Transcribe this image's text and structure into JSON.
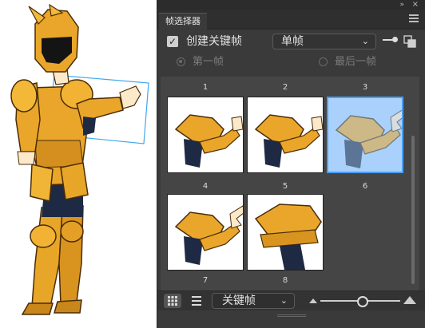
{
  "panel": {
    "tab_title": "帧选择器",
    "collapse_glyph": "»",
    "close_glyph": "×",
    "create_keyframe": {
      "label": "创建关键帧",
      "checked": true,
      "check_glyph": "✓"
    },
    "mode_dropdown": {
      "value": "单帧",
      "chevron": "⌄"
    },
    "radio_first": {
      "label": "第一帧",
      "selected": true,
      "enabled": false
    },
    "radio_last": {
      "label": "最后一帧",
      "selected": false,
      "enabled": false
    },
    "frames": [
      {
        "number": "1",
        "selected": false,
        "pose": "fist"
      },
      {
        "number": "2",
        "selected": false,
        "pose": "fist"
      },
      {
        "number": "3",
        "selected": true,
        "pose": "point"
      },
      {
        "number": "4",
        "selected": false,
        "pose": "point"
      },
      {
        "number": "5",
        "selected": false,
        "pose": "shoulder"
      },
      {
        "number": "6",
        "selected": false,
        "pose": "empty"
      },
      {
        "number": "7",
        "selected": false,
        "pose": "empty"
      },
      {
        "number": "8",
        "selected": false,
        "pose": "empty"
      }
    ],
    "bottom": {
      "view_grid_icon": "grid-view-icon",
      "view_list_icon": "list-view-icon",
      "filter_dropdown": {
        "value": "关键帧",
        "chevron": "⌄"
      },
      "zoom_level": 0.5
    }
  },
  "colors": {
    "panel_bg": "#3a3a3a",
    "grid_bg": "#454545",
    "selection_fill": "#a9d1fb",
    "selection_border": "#4b9ef5",
    "armor_gold": "#e8a628",
    "armor_dark": "#1e2a44",
    "bounding_box": "#41a7ea"
  }
}
